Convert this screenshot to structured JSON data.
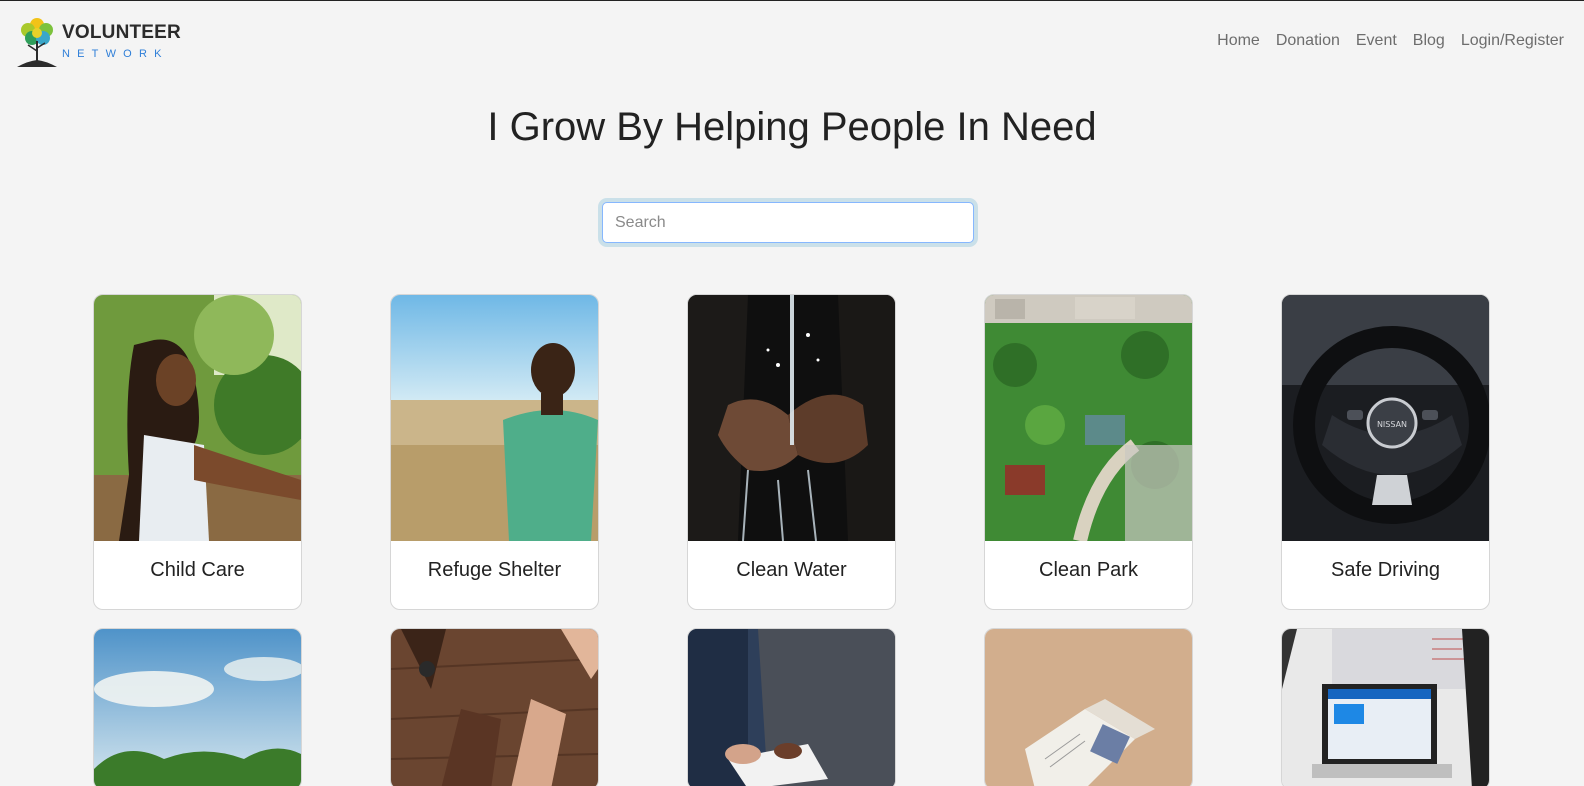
{
  "header": {
    "logo": {
      "title": "VOLUNTEER",
      "subtitle": "NETWORK"
    },
    "nav": [
      "Home",
      "Donation",
      "Event",
      "Blog",
      "Login/Register"
    ]
  },
  "main": {
    "title": "I Grow By Helping People In Need",
    "search": {
      "placeholder": "Search",
      "value": ""
    },
    "cards": [
      {
        "label": "Child Care",
        "image": "girl-in-park"
      },
      {
        "label": "Refuge Shelter",
        "image": "boy-in-field"
      },
      {
        "label": "Clean Water",
        "image": "hands-catching-water"
      },
      {
        "label": "Clean Park",
        "image": "aerial-green-park"
      },
      {
        "label": "Safe Driving",
        "image": "car-steering-wheel"
      },
      {
        "label": "",
        "image": "sky-and-trees"
      },
      {
        "label": "",
        "image": "hands-on-table"
      },
      {
        "label": "",
        "image": "person-with-notebook"
      },
      {
        "label": "",
        "image": "open-book"
      },
      {
        "label": "",
        "image": "laptop-code"
      }
    ]
  }
}
